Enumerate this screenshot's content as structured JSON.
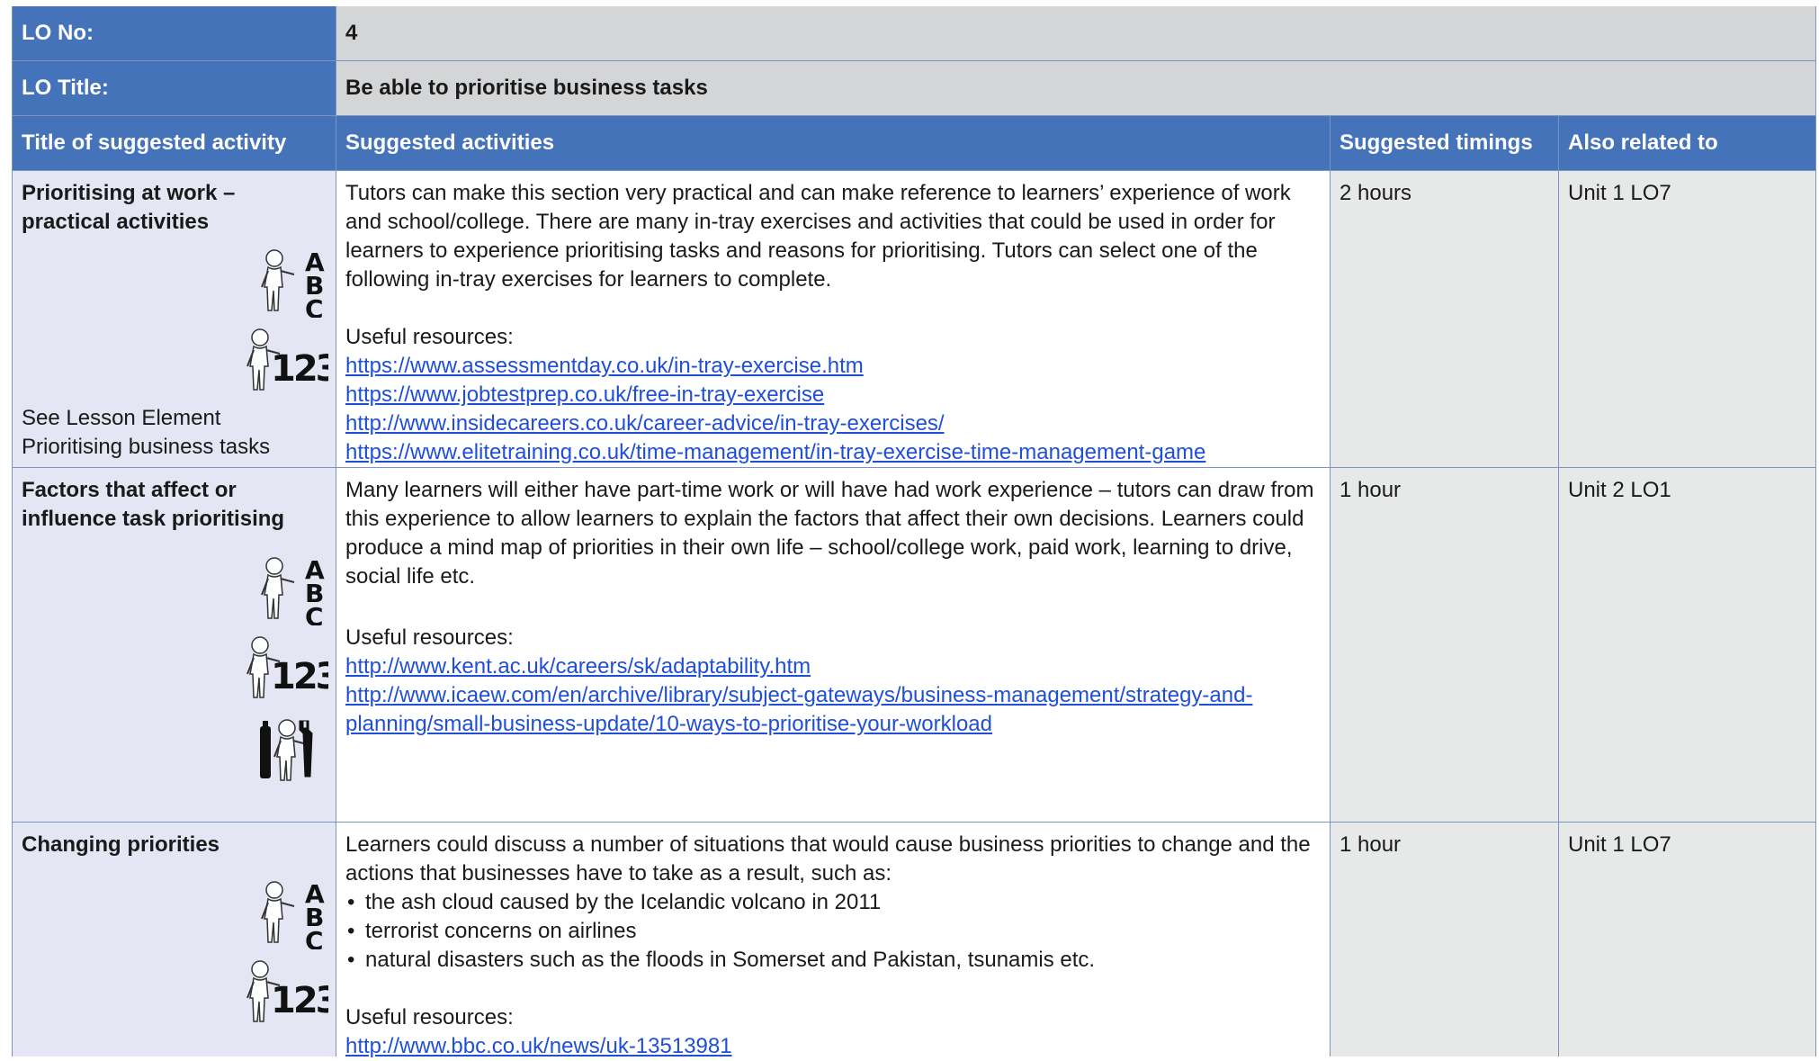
{
  "lo_no": {
    "label": "LO No:",
    "value": "4"
  },
  "lo_title": {
    "label": "LO Title:",
    "value": "Be able to prioritise business tasks"
  },
  "headers": {
    "title": "Title of suggested activity",
    "activities": "Suggested activities",
    "timings": "Suggested timings",
    "related": "Also related to"
  },
  "rows": [
    {
      "title": "Prioritising at work – practical activities",
      "icons": [
        "abc-reading-icon",
        "numeracy-123-icon"
      ],
      "note": "See Lesson Element Prioritising business tasks",
      "text": "Tutors can make this section very practical and can make reference to learners’ experience of work and school/college. There are many in-tray exercises and activities that could be used in order for learners to experience prioritising tasks and reasons for prioritising. Tutors can select one of the following in-tray exercises for learners to complete.",
      "resources_label": "Useful resources:",
      "links": [
        "https://www.assessmentday.co.uk/in-tray-exercise.htm",
        "https://www.jobtestprep.co.uk/free-in-tray-exercise",
        "http://www.insidecareers.co.uk/career-advice/in-tray-exercises/",
        "https://www.elitetraining.co.uk/time-management/in-tray-exercise-time-management-game"
      ],
      "timing": "2 hours",
      "related": "Unit 1 LO7"
    },
    {
      "title": "Factors that affect or influence task prioritising",
      "icons": [
        "abc-reading-icon",
        "numeracy-123-icon",
        "tools-skills-icon"
      ],
      "text": "Many learners will either have part-time work or will have had work experience – tutors can draw from this experience to allow learners to explain the factors that affect their own decisions. Learners could produce a mind map of priorities in their own life – school/college work, paid work, learning to drive, social life etc.",
      "resources_label": "Useful resources:",
      "links": [
        "http://www.kent.ac.uk/careers/sk/adaptability.htm",
        "http://www.icaew.com/en/archive/library/subject-gateways/business-management/strategy-and-planning/small-business-update/10-ways-to-prioritise-your-workload"
      ],
      "timing": "1 hour",
      "related": "Unit 2 LO1"
    },
    {
      "title": "Changing priorities",
      "icons": [
        "abc-reading-icon",
        "numeracy-123-icon"
      ],
      "text": "Learners could discuss a number of situations that would cause business priorities to change and the actions that businesses have to take as a result, such as:",
      "bullets": [
        "the ash cloud caused by the Icelandic volcano in 2011",
        "terrorist concerns on airlines",
        "natural disasters such as the floods in Somerset and Pakistan, tsunamis etc."
      ],
      "resources_label": "Useful resources:",
      "links": [
        "http://www.bbc.co.uk/news/uk-13513981"
      ],
      "timing": "1 hour",
      "related": "Unit 1 LO7"
    }
  ]
}
